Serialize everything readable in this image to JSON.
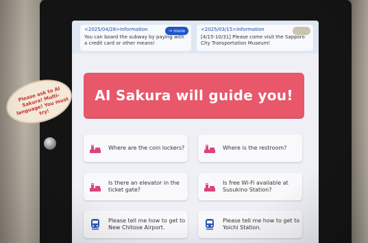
{
  "info": [
    {
      "date": "<2025/04/28>Information",
      "body": "You can board the subway by paying with a credit card or other means!",
      "more_label": "→ more"
    },
    {
      "date": "<2025/03/15>Information",
      "body": "[4/15-10/31] Please come visit the Sapporo City Transportation Museum!",
      "more_label": ""
    }
  ],
  "hero": {
    "title": "AI Sakura will guide you!"
  },
  "questions": [
    {
      "label": "Where are the coin lockers?",
      "icon": "station-icon"
    },
    {
      "label": "Where is the restroom?",
      "icon": "station-icon"
    },
    {
      "label": "Is there an elevator in the ticket gate?",
      "icon": "station-icon"
    },
    {
      "label": "Is free Wi-Fi available at Susukino Station?",
      "icon": "station-icon"
    },
    {
      "label": "Please tell me how to get to New Chitose Airport.",
      "icon": "train-icon"
    },
    {
      "label": "Please tell me how to get to Yoichi Station.",
      "icon": "train-icon"
    }
  ],
  "sticker": {
    "text": "Please ask to AI Sakura! Multi-language! You must try!"
  },
  "colors": {
    "hero": "#e8576a",
    "icon": "#d8457a",
    "train_icon": "#2b56b8",
    "more": "#1e56c8"
  }
}
